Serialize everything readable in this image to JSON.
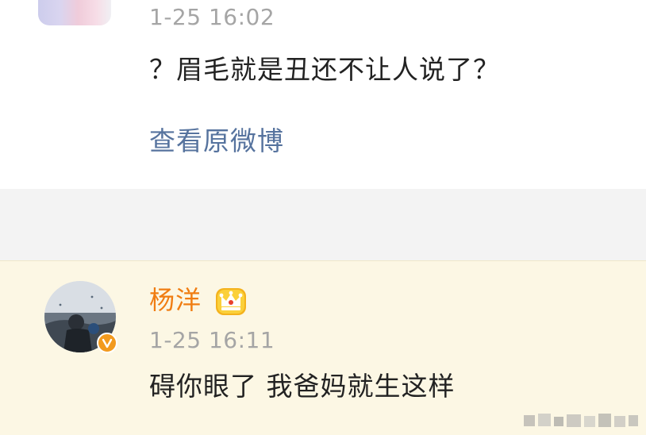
{
  "top_comment": {
    "timestamp": "1-25 16:02",
    "text": "？眉毛就是丑还不让人说了？",
    "view_original_label": "查看原微博"
  },
  "reply": {
    "username": "杨洋",
    "timestamp": "1-25 16:11",
    "text": "碍你眼了 我爸妈就生这样",
    "verified_icon": "verified-v-badge-icon",
    "member_icon": "crown-icon"
  },
  "colors": {
    "link": "#56739e",
    "username": "#f07d12",
    "timestamp": "#a5a5a5",
    "highlight_bg": "#fcf7e4",
    "separator_bg": "#f3f3f3"
  }
}
